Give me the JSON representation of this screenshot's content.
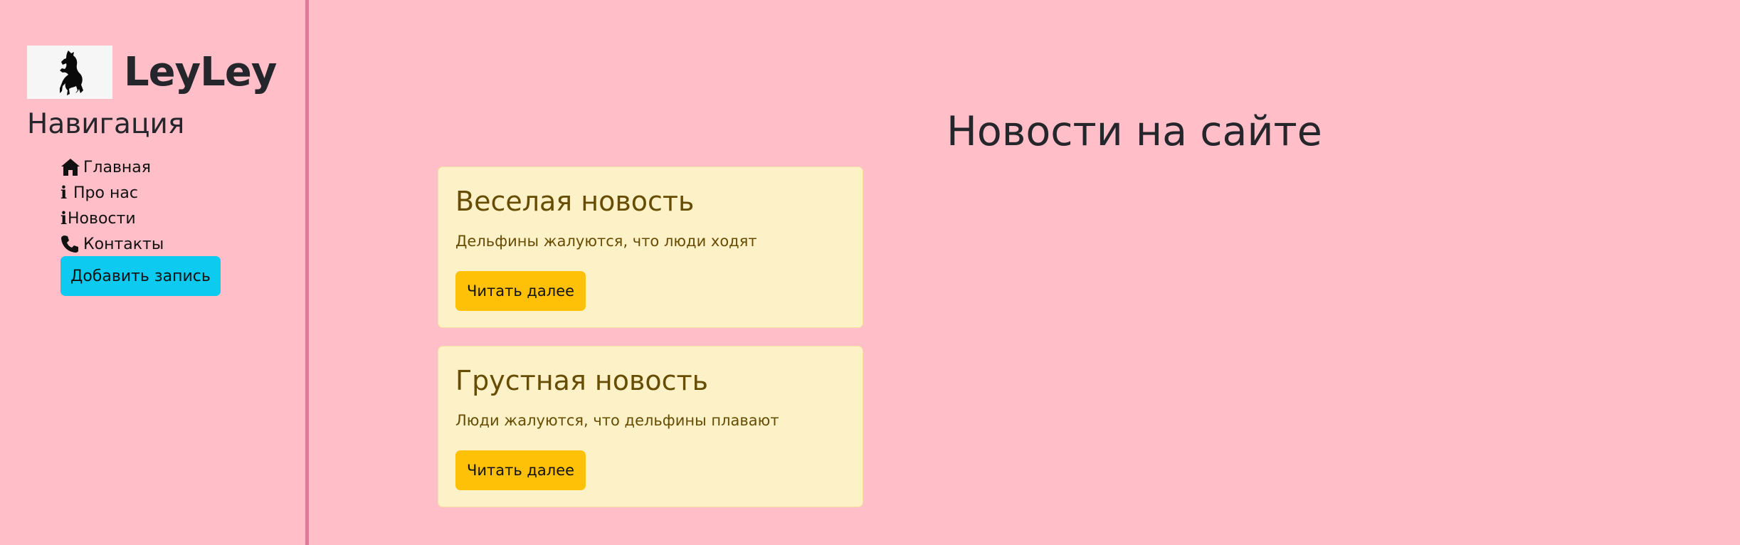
{
  "brand": {
    "name": "LeyLey",
    "logo_icon": "rearing-horse-icon"
  },
  "sidebar": {
    "title": "Навигация",
    "items": [
      {
        "label": "Главная",
        "icon": "home-icon"
      },
      {
        "label": "Про нас",
        "icon": "info-icon"
      },
      {
        "label": "Новости",
        "icon": "info-icon"
      },
      {
        "label": "Контакты",
        "icon": "phone-icon"
      }
    ],
    "add_button_label": "Добавить запись"
  },
  "main": {
    "title": "Новости на сайте",
    "news": [
      {
        "title": "Веселая новость",
        "text": "Дельфины жалуются, что люди ходят",
        "button_label": "Читать далее"
      },
      {
        "title": "Грустная новость",
        "text": "Люди жалуются, что дельфины плавают",
        "button_label": "Читать далее"
      }
    ]
  },
  "colors": {
    "background": "#ffbec8",
    "divider": "#df7a98",
    "info_button": "#0dcaf0",
    "warning_button": "#ffc107",
    "card_background": "#fdf1c8",
    "card_text": "#664d03"
  }
}
